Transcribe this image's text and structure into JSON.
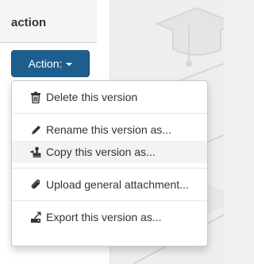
{
  "table": {
    "column_header": "action"
  },
  "action_button": {
    "label": "Action:"
  },
  "menu": {
    "items": [
      {
        "label": "Delete this version",
        "icon": "trash-icon"
      },
      {
        "label": "Rename this version as...",
        "icon": "pencil-icon"
      },
      {
        "label": "Copy this version as...",
        "icon": "copy-stamp-icon"
      },
      {
        "label": "Upload general attachment...",
        "icon": "paperclip-icon"
      },
      {
        "label": "Export this version as...",
        "icon": "export-icon"
      }
    ]
  },
  "colors": {
    "button_bg": "#1c5f8e",
    "menu_hover": "#f3f3f3",
    "text": "#333333"
  }
}
